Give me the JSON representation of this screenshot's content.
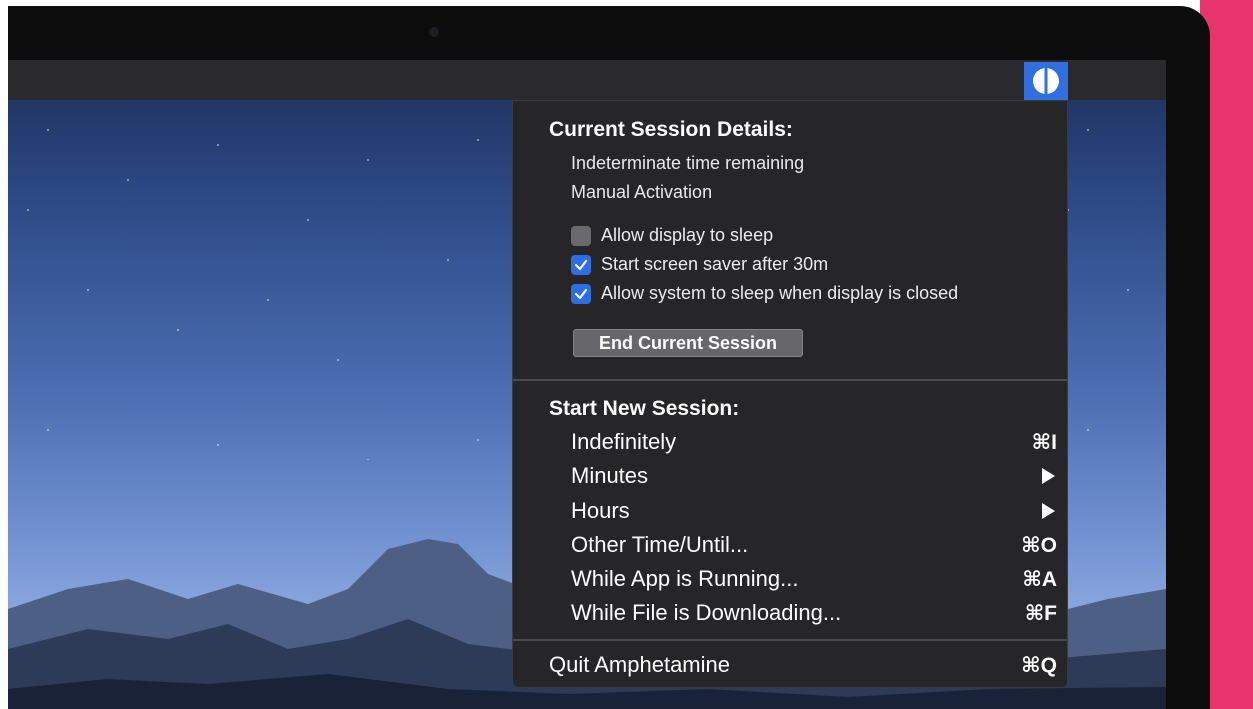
{
  "colors": {
    "accent_pink": "#e8356d",
    "menu_bg": "#262628",
    "checkbox_on": "#2d6fe3",
    "status_icon_bg": "#2f6fe0"
  },
  "menubar": {
    "status_icon": "amphetamine-pill-icon"
  },
  "current_session": {
    "title": "Current Session Details:",
    "time_remaining": "Indeterminate time remaining",
    "activation": "Manual Activation",
    "options": [
      {
        "label": "Allow display to sleep",
        "checked": false
      },
      {
        "label": "Start screen saver after 30m",
        "checked": true
      },
      {
        "label": "Allow system to sleep when display is closed",
        "checked": true
      }
    ],
    "end_button_label": "End Current Session"
  },
  "new_session": {
    "title": "Start New Session:",
    "items": [
      {
        "label": "Indefinitely",
        "shortcut": "⌘I"
      },
      {
        "label": "Minutes",
        "submenu": true
      },
      {
        "label": "Hours",
        "submenu": true
      },
      {
        "label": "Other Time/Until...",
        "shortcut": "⌘O"
      },
      {
        "label": "While App is Running...",
        "shortcut": "⌘A"
      },
      {
        "label": "While File is Downloading...",
        "shortcut": "⌘F"
      }
    ]
  },
  "quit": {
    "label": "Quit Amphetamine",
    "shortcut": "⌘Q"
  }
}
